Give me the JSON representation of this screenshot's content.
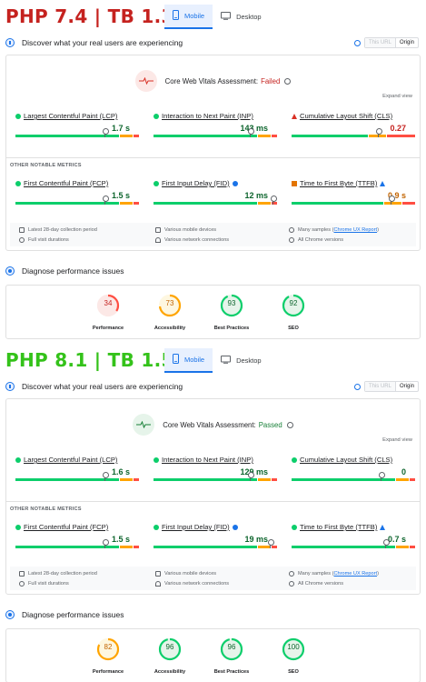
{
  "panels": [
    {
      "title": "PHP 7.4 | TB 1.3.0",
      "title_color": "#c5221f",
      "tabs": {
        "mobile": "Mobile",
        "desktop": "Desktop"
      },
      "section_title": "Discover what your real users are experiencing",
      "url_toggle": {
        "this_url": "This URL",
        "origin": "Origin"
      },
      "assessment": {
        "label": "Core Web Vitals Assessment:",
        "status": "Failed",
        "status_color": "#c5221f"
      },
      "expand_view": "Expand view",
      "other_metrics_label": "OTHER NOTABLE METRICS",
      "metrics": [
        {
          "name": "Largest Contentful Paint (LCP)",
          "value": "1.7 s",
          "status": "good",
          "marker": 0.72
        },
        {
          "name": "Interaction to Next Paint (INP)",
          "value": "143 ms",
          "status": "good",
          "marker": 0.78
        },
        {
          "name": "Cumulative Layout Shift (CLS)",
          "value": "0.27",
          "status": "poor",
          "marker": 0.7
        },
        {
          "name": "First Contentful Paint (FCP)",
          "value": "1.5 s",
          "status": "good",
          "marker": 0.72
        },
        {
          "name": "First Input Delay (FID)",
          "value": "12 ms",
          "status": "good",
          "marker": 0.96
        },
        {
          "name": "Time to First Byte (TTFB)",
          "value": "0.9 s",
          "status": "needs-improvement",
          "marker": 0.8
        }
      ],
      "footer": {
        "period": "Latest 28-day collection period",
        "durations": "Full visit durations",
        "devices": "Various mobile devices",
        "network": "Various network connections",
        "samples_prefix": "Many samples (",
        "samples_link": "Chrome UX Report",
        "samples_suffix": ")",
        "versions": "All Chrome versions"
      },
      "diagnose_title": "Diagnose performance issues",
      "scores": [
        {
          "label": "Performance",
          "score": 34,
          "color": "#c5221f",
          "ring": "#ff4e42",
          "bg": "#fce8e6"
        },
        {
          "label": "Accessibility",
          "score": 73,
          "color": "#c26401",
          "ring": "#ffa400",
          "bg": "#fef7e0"
        },
        {
          "label": "Best Practices",
          "score": 93,
          "color": "#0d652d",
          "ring": "#0cce6b",
          "bg": "#e6f4ea"
        },
        {
          "label": "SEO",
          "score": 92,
          "color": "#0d652d",
          "ring": "#0cce6b",
          "bg": "#e6f4ea"
        }
      ]
    },
    {
      "title": "PHP 8.1 | TB 1.5.1",
      "title_color": "#34c21a",
      "tabs": {
        "mobile": "Mobile",
        "desktop": "Desktop"
      },
      "section_title": "Discover what your real users are experiencing",
      "url_toggle": {
        "this_url": "This URL",
        "origin": "Origin"
      },
      "assessment": {
        "label": "Core Web Vitals Assessment:",
        "status": "Passed",
        "status_color": "#188038"
      },
      "expand_view": "Expand view",
      "other_metrics_label": "OTHER NOTABLE METRICS",
      "metrics": [
        {
          "name": "Largest Contentful Paint (LCP)",
          "value": "1.6 s",
          "status": "good",
          "marker": 0.72
        },
        {
          "name": "Interaction to Next Paint (INP)",
          "value": "129 ms",
          "status": "good",
          "marker": 0.78
        },
        {
          "name": "Cumulative Layout Shift (CLS)",
          "value": "0",
          "status": "good",
          "marker": 0.72
        },
        {
          "name": "First Contentful Paint (FCP)",
          "value": "1.5 s",
          "status": "good",
          "marker": 0.72
        },
        {
          "name": "First Input Delay (FID)",
          "value": "19 ms",
          "status": "good",
          "marker": 0.94
        },
        {
          "name": "Time to First Byte (TTFB)",
          "value": "0.7 s",
          "status": "good",
          "marker": 0.76
        }
      ],
      "footer": {
        "period": "Latest 28-day collection period",
        "durations": "Full visit durations",
        "devices": "Various mobile devices",
        "network": "Various network connections",
        "samples_prefix": "Many samples (",
        "samples_link": "Chrome UX Report",
        "samples_suffix": ")",
        "versions": "All Chrome versions"
      },
      "diagnose_title": "Diagnose performance issues",
      "scores": [
        {
          "label": "Performance",
          "score": 82,
          "color": "#c26401",
          "ring": "#ffa400",
          "bg": "#fef7e0"
        },
        {
          "label": "Accessibility",
          "score": 96,
          "color": "#0d652d",
          "ring": "#0cce6b",
          "bg": "#e6f4ea"
        },
        {
          "label": "Best Practices",
          "score": 96,
          "color": "#0d652d",
          "ring": "#0cce6b",
          "bg": "#e6f4ea"
        },
        {
          "label": "SEO",
          "score": 100,
          "color": "#0d652d",
          "ring": "#0cce6b",
          "bg": "#e6f4ea"
        }
      ]
    }
  ]
}
